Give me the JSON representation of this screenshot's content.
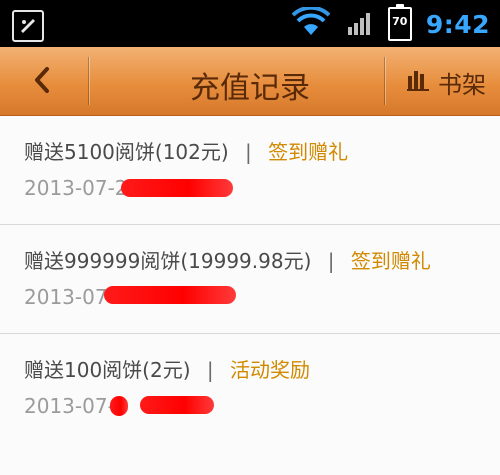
{
  "status_bar": {
    "time": "9:42",
    "battery": "70",
    "icons": [
      "app-notification-icon",
      "wifi-icon",
      "signal-icon",
      "battery-icon"
    ]
  },
  "app_bar": {
    "title": "充值记录",
    "back_icon": "back-arrow-icon",
    "shelf_label": "书架",
    "shelf_icon": "bar-chart-icon"
  },
  "records": [
    {
      "text": "赠送5100阅饼(102元)",
      "separator": "|",
      "tag": "签到赠礼",
      "date": "2013-07-2"
    },
    {
      "text": "赠送999999阅饼(19999.98元)",
      "separator": "|",
      "tag": "签到赠礼",
      "date": "2013-07"
    },
    {
      "text": "赠送100阅饼(2元)",
      "separator": "|",
      "tag": "活动奖励",
      "date": "2013-07-"
    }
  ],
  "colors": {
    "appbar_orange": "#e78e3d",
    "title_brown": "#5a2a08",
    "tag_gold": "#d18a00",
    "date_gray": "#9b9b9b",
    "time_blue": "#38a7ff"
  }
}
